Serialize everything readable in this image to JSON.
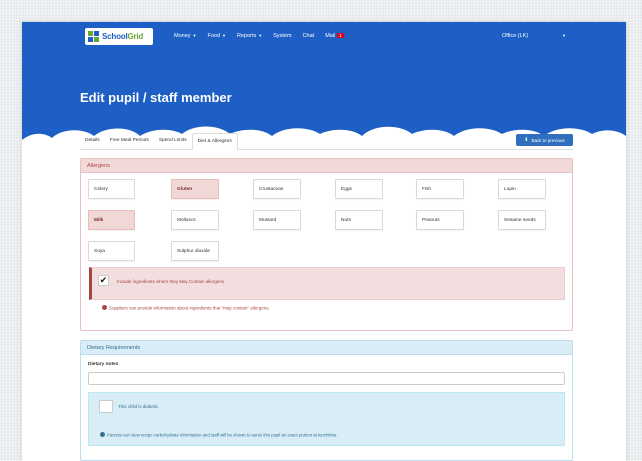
{
  "app": {
    "logo_school": "School",
    "logo_grid": "Grid"
  },
  "navbar": {
    "items": [
      "Money",
      "Food",
      "Reports",
      "System",
      "Chat",
      "Mail"
    ],
    "mail_badge": "1",
    "right_label": "Office (LK)"
  },
  "header": {
    "title": "Edit pupil / staff member"
  },
  "tabs": [
    "Details",
    "Free Meal Periods",
    "Spend Limits",
    "Diet & Allergens"
  ],
  "active_tab": "Diet & Allergens",
  "back_button": "Back to previous",
  "allergens": {
    "title": "Allergens",
    "items": [
      {
        "label": "Celery",
        "selected": false
      },
      {
        "label": "Gluten",
        "selected": true
      },
      {
        "label": "Crustaceas",
        "selected": false
      },
      {
        "label": "Eggs",
        "selected": false
      },
      {
        "label": "Fish",
        "selected": false
      },
      {
        "label": "Lupin",
        "selected": false
      },
      {
        "label": "Milk",
        "selected": true
      },
      {
        "label": "Molluscs",
        "selected": false
      },
      {
        "label": "Mustard",
        "selected": false
      },
      {
        "label": "Nuts",
        "selected": false
      },
      {
        "label": "Peanuts",
        "selected": false
      },
      {
        "label": "Sesame seeds",
        "selected": false
      },
      {
        "label": "Soya",
        "selected": false
      },
      {
        "label": "Sulphur dioxide",
        "selected": false
      }
    ],
    "include_may_contain_label": "Include ingredients where they May Contain allergens.",
    "include_may_contain_checked": true,
    "supplier_note": "Suppliers can provide information about ingredients that \"may contain\" allergens."
  },
  "dietary": {
    "title": "Dietary Requirements",
    "notes_label": "Dietary notes",
    "notes_value": "",
    "diabetic_label": "This child is diabetic",
    "diabetic_checked": false,
    "diabetic_note": "Parents can view recipe carbohydrate information and staff will be shown to serve this pupil an exact portion at lunchtime."
  },
  "colors": {
    "brand_blue": "#1d5fc4",
    "danger_bg": "#f2dede",
    "danger_text": "#a94442",
    "info_bg": "#d9edf7",
    "info_text": "#31708f",
    "button_blue": "#2f6fbd"
  }
}
